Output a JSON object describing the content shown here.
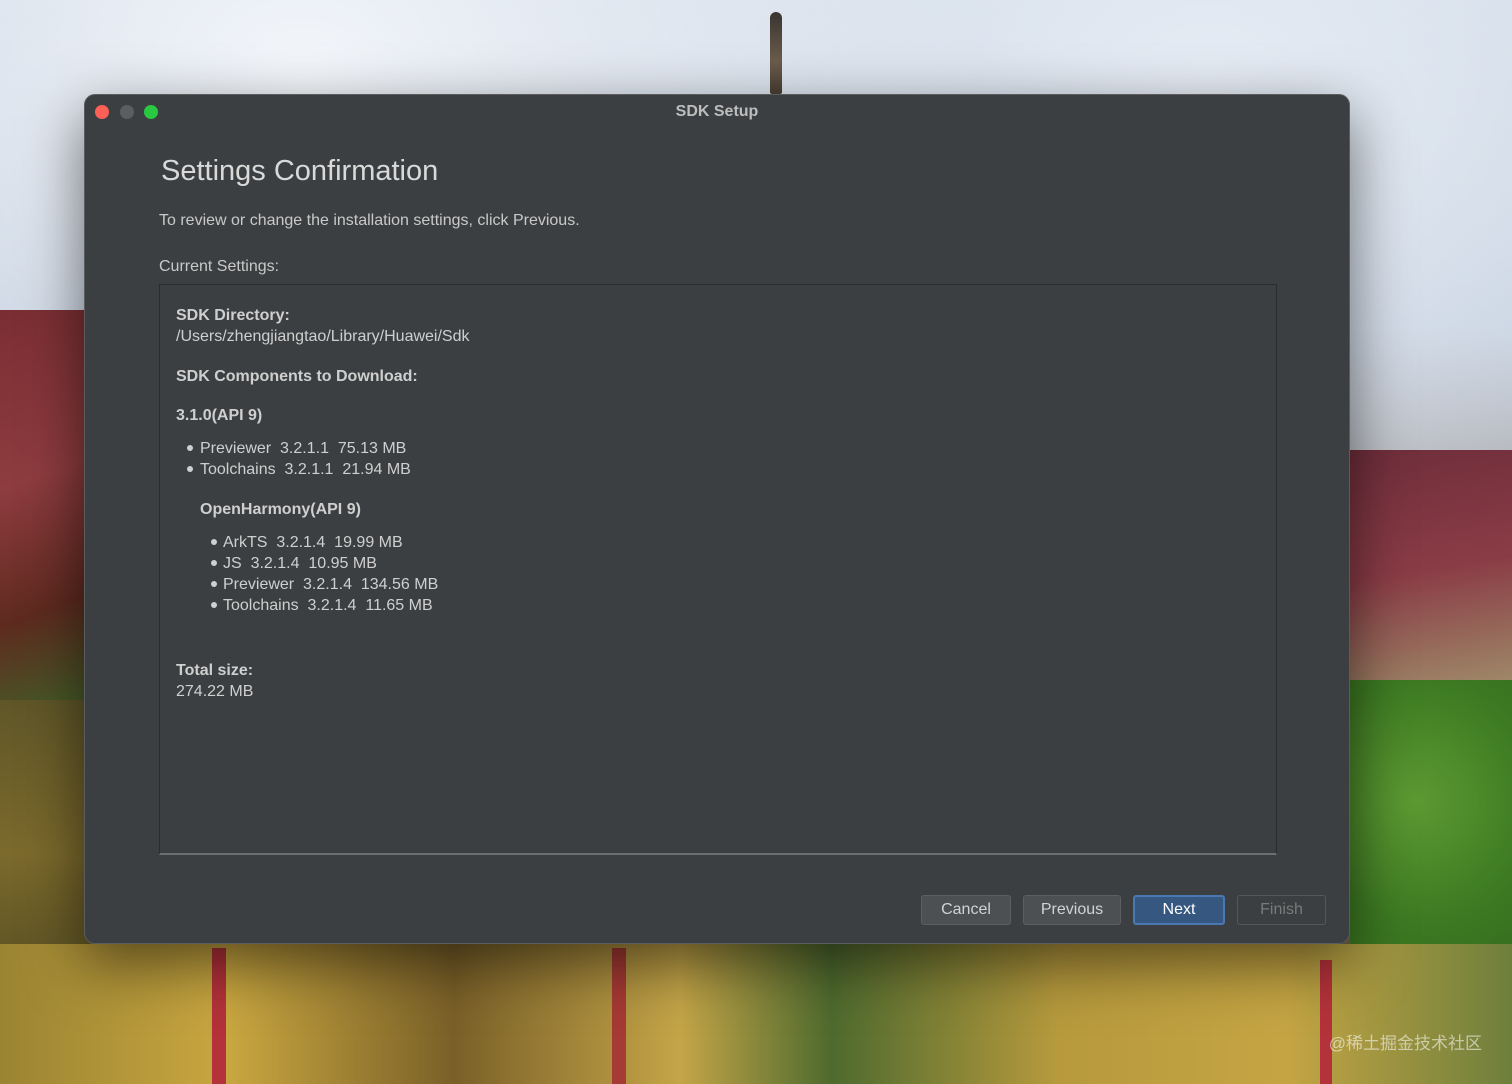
{
  "window": {
    "title": "SDK Setup"
  },
  "page": {
    "heading": "Settings Confirmation",
    "subtitle": "To review or change the installation settings, click Previous.",
    "current_label": "Current Settings:"
  },
  "settings": {
    "sdk_directory_label": "SDK Directory:",
    "sdk_directory": "/Users/zhengjiangtao/Library/Huawei/Sdk",
    "components_label": "SDK Components to Download:",
    "groups": [
      {
        "name": "3.1.0(API 9)",
        "items": [
          {
            "name": "Previewer",
            "version": "3.2.1.1",
            "size": "75.13 MB"
          },
          {
            "name": "Toolchains",
            "version": "3.2.1.1",
            "size": "21.94 MB"
          }
        ]
      },
      {
        "name": "OpenHarmony(API 9)",
        "items": [
          {
            "name": "ArkTS",
            "version": "3.2.1.4",
            "size": "19.99 MB"
          },
          {
            "name": "JS",
            "version": "3.2.1.4",
            "size": "10.95 MB"
          },
          {
            "name": "Previewer",
            "version": "3.2.1.4",
            "size": "134.56 MB"
          },
          {
            "name": "Toolchains",
            "version": "3.2.1.4",
            "size": "11.65 MB"
          }
        ]
      }
    ],
    "total_label": "Total size:",
    "total_value": "274.22 MB"
  },
  "buttons": {
    "cancel": "Cancel",
    "previous": "Previous",
    "next": "Next",
    "finish": "Finish"
  },
  "watermark": "@稀土掘金技术社区",
  "colors": {
    "window_bg": "#3c3f41",
    "accent": "#365880",
    "close": "#fe5f57",
    "maximize": "#28c840"
  }
}
